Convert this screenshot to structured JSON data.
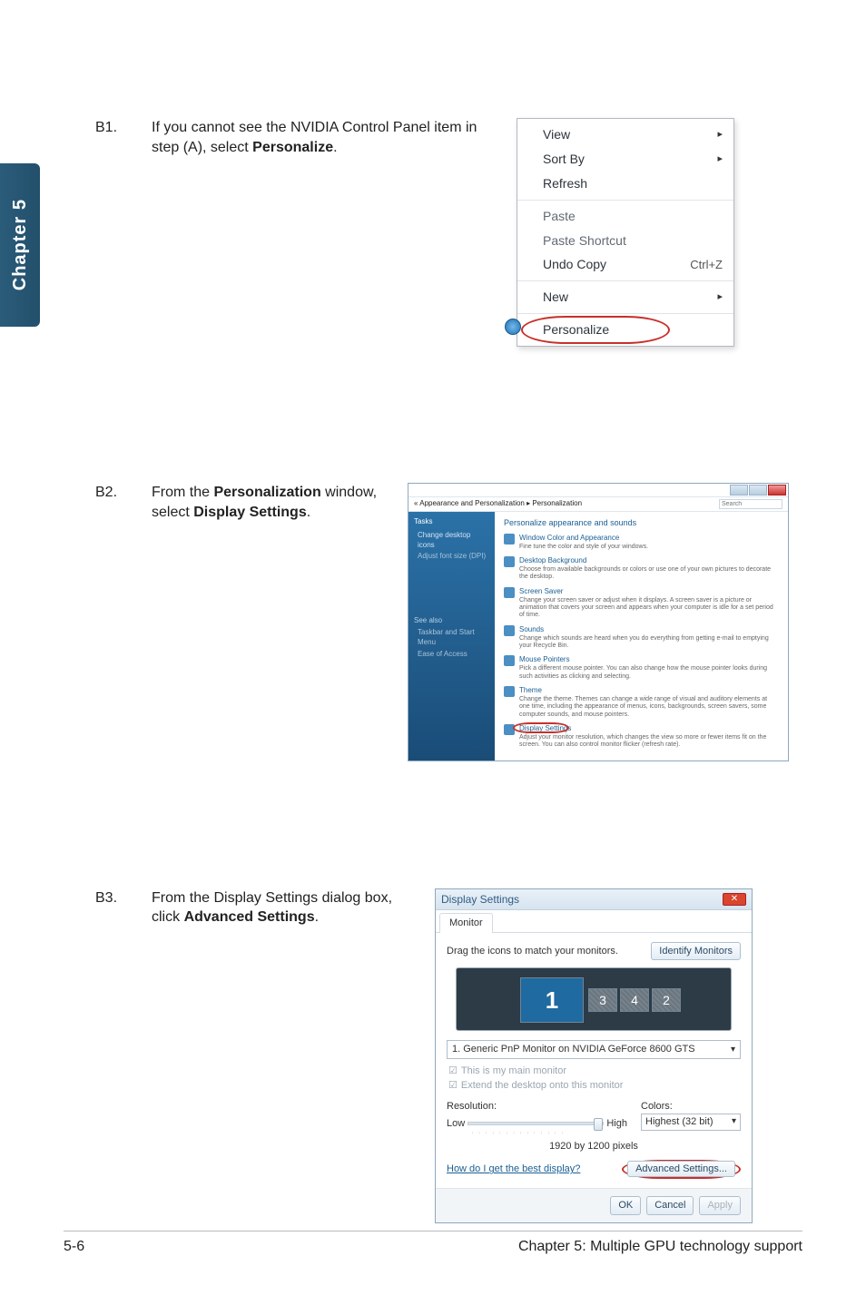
{
  "side_tab": "Chapter 5",
  "steps": {
    "b1": {
      "label": "B1.",
      "text_before": "If you cannot see the NVIDIA Control Panel item in step (A), select ",
      "bold": "Personalize",
      "text_after": "."
    },
    "b2": {
      "label": "B2.",
      "text_before": "From the ",
      "bold1": "Personalization",
      "text_mid": " window, select ",
      "bold2": "Display Settings",
      "text_after": "."
    },
    "b3": {
      "label": "B3.",
      "text_before": "From the Display Settings dialog box, click ",
      "bold": "Advanced Settings",
      "text_after": "."
    }
  },
  "ctxmenu": {
    "view": "View",
    "sortby": "Sort By",
    "refresh": "Refresh",
    "paste": "Paste",
    "paste_shortcut": "Paste Shortcut",
    "undo_copy": "Undo Copy",
    "undo_shortcut": "Ctrl+Z",
    "new": "New",
    "personalize": "Personalize"
  },
  "pwin": {
    "addr": "« Appearance and Personalization  ▸  Personalization",
    "search_ph": "Search",
    "sidebar": {
      "tasks": "Tasks",
      "l1": "Change desktop icons",
      "l2": "Adjust font size (DPI)",
      "seealso": "See also",
      "s1": "Taskbar and Start Menu",
      "s2": "Ease of Access"
    },
    "main_heading": "Personalize appearance and sounds",
    "entries": [
      {
        "t": "Window Color and Appearance",
        "d": "Fine tune the color and style of your windows."
      },
      {
        "t": "Desktop Background",
        "d": "Choose from available backgrounds or colors or use one of your own pictures to decorate the desktop."
      },
      {
        "t": "Screen Saver",
        "d": "Change your screen saver or adjust when it displays. A screen saver is a picture or animation that covers your screen and appears when your computer is idle for a set period of time."
      },
      {
        "t": "Sounds",
        "d": "Change which sounds are heard when you do everything from getting e-mail to emptying your Recycle Bin."
      },
      {
        "t": "Mouse Pointers",
        "d": "Pick a different mouse pointer. You can also change how the mouse pointer looks during such activities as clicking and selecting."
      },
      {
        "t": "Theme",
        "d": "Change the theme. Themes can change a wide range of visual and auditory elements at one time, including the appearance of menus, icons, backgrounds, screen savers, some computer sounds, and mouse pointers."
      },
      {
        "t": "Display Settings",
        "d": "Adjust your monitor resolution, which changes the view so more or fewer items fit on the screen. You can also control monitor flicker (refresh rate)."
      }
    ]
  },
  "dswin": {
    "title": "Display Settings",
    "tab": "Monitor",
    "drag_label": "Drag the icons to match your monitors.",
    "identify": "Identify Monitors",
    "mon": {
      "m1": "1",
      "m3": "3",
      "m4": "4",
      "m2": "2"
    },
    "combo": "1. Generic PnP Monitor on NVIDIA GeForce 8600 GTS",
    "chk1": "This is my main monitor",
    "chk2": "Extend the desktop onto this monitor",
    "reslabel": "Resolution:",
    "low": "Low",
    "high": "High",
    "resval": "1920 by 1200 pixels",
    "colorslabel": "Colors:",
    "colorsval": "Highest (32 bit)",
    "helplink": "How do I get the best display?",
    "advbtn": "Advanced Settings...",
    "ok": "OK",
    "cancel": "Cancel",
    "apply": "Apply"
  },
  "footer": {
    "left": "5-6",
    "right": "Chapter 5: Multiple GPU technology support"
  }
}
